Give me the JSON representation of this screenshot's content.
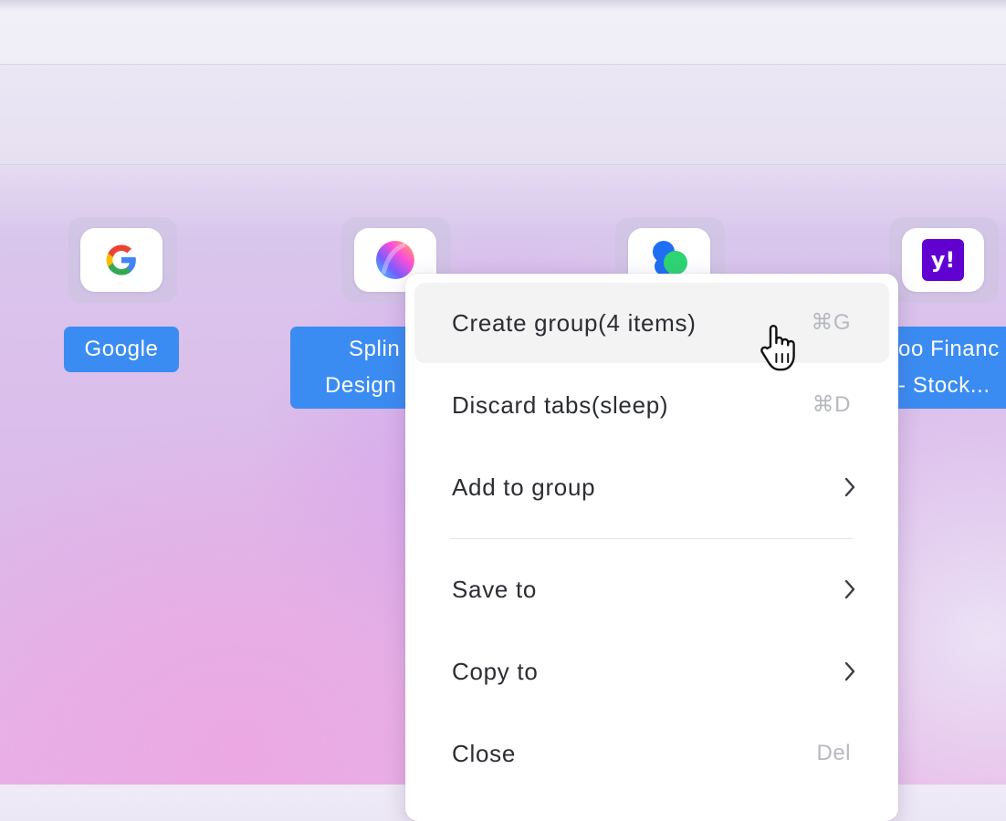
{
  "tiles": [
    {
      "name": "google",
      "label_lines": [
        "Google"
      ]
    },
    {
      "name": "spline",
      "label_lines": [
        "Splin",
        "Design"
      ]
    },
    {
      "name": "third",
      "label_lines": []
    },
    {
      "name": "yahoo",
      "label_lines": [
        "oo Financ",
        "- Stock..."
      ],
      "icon_text": "y!"
    }
  ],
  "context_menu": {
    "items": [
      {
        "label": "Create group(4 items)",
        "shortcut": "⌘G"
      },
      {
        "label": "Discard tabs(sleep)",
        "shortcut": "⌘D"
      },
      {
        "label": "Add to group",
        "submenu_icon": "chevron-right-icon"
      },
      {
        "label": "Save to",
        "submenu_icon": "chevron-right-icon"
      },
      {
        "label": "Copy to",
        "submenu_icon": "chevron-right-icon"
      },
      {
        "label": "Close",
        "shortcut": "Del"
      }
    ]
  },
  "colors": {
    "selection_label": "#3b8cf2",
    "yahoo_brand": "#6001d2",
    "menu_hover": "#f3f3f4"
  }
}
